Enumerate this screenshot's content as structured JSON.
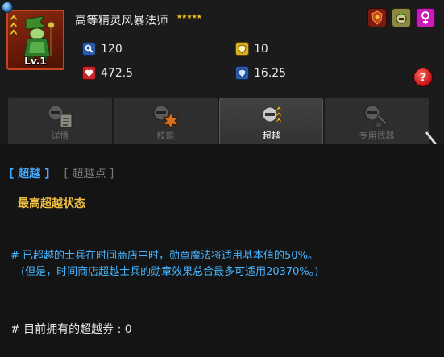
{
  "unit": {
    "name": "高等精灵风暴法师",
    "stars": "★★★★★",
    "level": "Lv.1"
  },
  "stats": {
    "attack": "120",
    "defense": "10",
    "hp": "472.5",
    "magic_defense": "16.25"
  },
  "top_icons": [
    "badge-icon",
    "helmet-icon",
    "female-icon"
  ],
  "help_label": "?",
  "tabs": [
    {
      "label": "详情",
      "icon": "scroll-icon",
      "active": false
    },
    {
      "label": "技能",
      "icon": "burst-icon",
      "active": false
    },
    {
      "label": "超越",
      "icon": "chevron-rank-icon",
      "active": true
    },
    {
      "label": "专用武器",
      "icon": "weapon-icon",
      "active": false
    }
  ],
  "subtabs": {
    "active": "[ 超越 ]",
    "inactive": "[ 超越点 ]"
  },
  "max_state": "最高超越状态",
  "notes": {
    "line1": "# 已超越的士兵在时间商店中时，勋章魔法将适用基本值的50%。",
    "line2": "(但是，时间商店超越士兵的勋章效果总合最多可适用20370%。)"
  },
  "owned_tickets": "# 目前拥有的超越券 : 0",
  "colors": {
    "accent_blue": "#46b4ff",
    "gold": "#f0c040",
    "portrait_border": "#c8441c"
  }
}
